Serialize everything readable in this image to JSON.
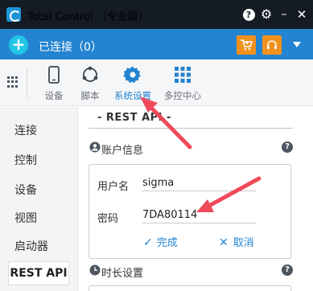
{
  "window": {
    "title": "Total Control （专业版）",
    "help_glyph": "?",
    "settings_glyph": "⚙",
    "minimize_glyph": "–",
    "close_glyph": "✕"
  },
  "connection_bar": {
    "add_glyph": "+",
    "status": "已连接（0）",
    "cart_icon": "cart-icon",
    "headset_icon": "headset-icon",
    "menu_icon": "chevron-down-icon"
  },
  "toolbar": {
    "items": [
      {
        "label": "设备",
        "icon": "phone-icon",
        "active": false
      },
      {
        "label": "脚本",
        "icon": "script-icon",
        "active": false
      },
      {
        "label": "系统设置",
        "icon": "gear-icon",
        "active": true
      },
      {
        "label": "多控中心",
        "icon": "grid-icon",
        "active": false
      }
    ]
  },
  "sidebar": {
    "items": [
      {
        "label": "连接"
      },
      {
        "label": "控制"
      },
      {
        "label": "设备"
      },
      {
        "label": "视图"
      },
      {
        "label": "启动器"
      },
      {
        "label": "REST API",
        "selected": true
      }
    ]
  },
  "content": {
    "section_title": "- REST API -",
    "account_header": "账户信息",
    "username_label": "用户名",
    "username_value": "sigma",
    "password_label": "密码",
    "password_value": "7DA80114",
    "confirm_label": "完成",
    "cancel_label": "取消",
    "duration_header": "时长设置",
    "help_glyph": "?"
  },
  "colors": {
    "titlebar": "#141b24",
    "connbar": "#2484d1",
    "accent": "#2484d1",
    "orange": "#f2911e",
    "annotation_arrow": "#f04a5a"
  }
}
